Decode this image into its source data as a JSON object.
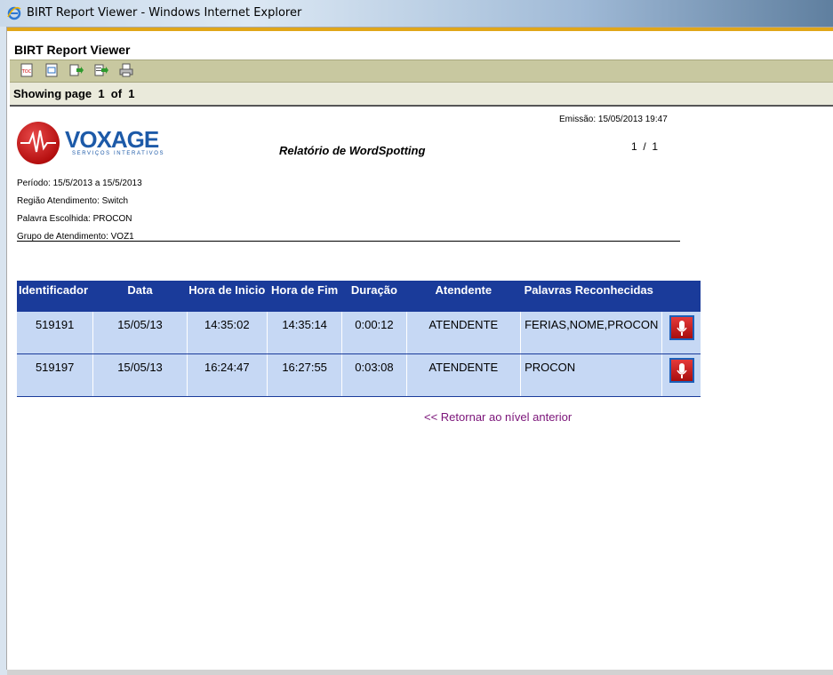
{
  "window": {
    "title": "BIRT Report Viewer - Windows Internet Explorer"
  },
  "viewer": {
    "title": "BIRT Report Viewer",
    "toolbar_icons": [
      "toc-icon",
      "parameters-icon",
      "export-data-icon",
      "export-report-icon",
      "print-icon"
    ],
    "nav_text": "Showing page  1  of  1"
  },
  "report": {
    "logo": {
      "name": "VOXAGE",
      "tagline": "SERVIÇOS INTERATIVOS"
    },
    "title": "Relatório de WordSpotting",
    "emissao": "Emissão: 15/05/2013 19:47",
    "pager": "1  /  1",
    "meta": [
      "Período: 15/5/2013 a 15/5/2013",
      "Região Atendimento: Switch",
      "Palavra Escolhida: PROCON",
      "Grupo de Atendimento: VOZ1"
    ],
    "columns": [
      "Identificador",
      "Data",
      "Hora de Inicio",
      "Hora de Fim",
      "Duração",
      "Atendente",
      "Palavras Reconhecidas"
    ],
    "rows": [
      [
        "519191",
        "15/05/13",
        "14:35:02",
        "14:35:14",
        "0:00:12",
        "ATENDENTE",
        "FERIAS,NOME,PROCON"
      ],
      [
        "519197",
        "15/05/13",
        "16:24:47",
        "16:27:55",
        "0:03:08",
        "ATENDENTE",
        "PROCON"
      ]
    ],
    "row_action_icon": "microphone-icon",
    "back_link": "<< Retornar ao nível anterior"
  },
  "colors": {
    "header_bg": "#1a3b9a",
    "row_bg": "#c6d8f4",
    "toolbar_bg": "#c8c8a0",
    "gold_accent": "#e0a619",
    "link": "#7b1479"
  }
}
